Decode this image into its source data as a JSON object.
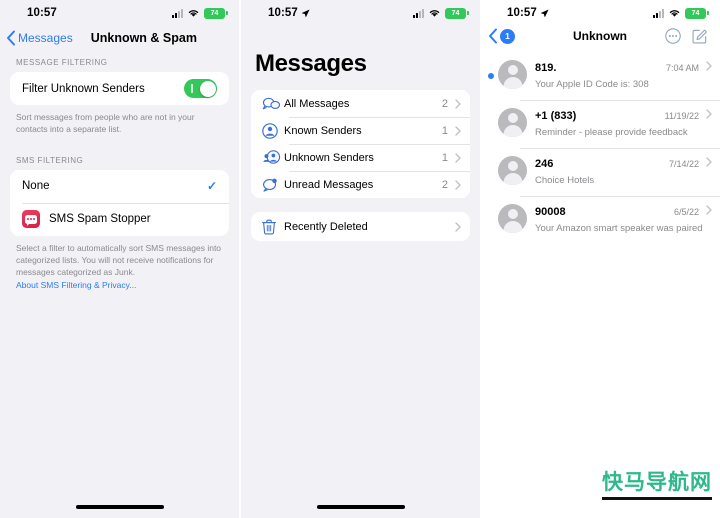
{
  "status_bar": {
    "time": "10:57",
    "battery_level": "74",
    "battery_color": "#34c759",
    "location_icon": "location-arrow-icon",
    "wifi_icon": "wifi-icon",
    "cellular_icon": "cellular-signal-icon"
  },
  "panel1": {
    "nav": {
      "back_label": "Messages",
      "title": "Unknown & Spam",
      "back_icon": "chevron-left-icon"
    },
    "message_filtering": {
      "section_header": "MESSAGE FILTERING",
      "row_label": "Filter Unknown Senders",
      "toggle_state": "on",
      "toggle_color": "#34c759",
      "footnote": "Sort messages from people who are not in your contacts into a separate list."
    },
    "sms_filtering": {
      "section_header": "SMS FILTERING",
      "options": [
        {
          "label": "None",
          "selected": true,
          "icon": null
        },
        {
          "label": "SMS Spam Stopper",
          "selected": false,
          "icon": "sms-spam-stopper-app-icon"
        }
      ],
      "footnote": "Select a filter to automatically sort SMS messages into categorized lists. You will not receive notifications for messages categorized as Junk.",
      "link_label": "About SMS Filtering & Privacy..."
    }
  },
  "panel2": {
    "title": "Messages",
    "filters": [
      {
        "label": "All Messages",
        "count": "2",
        "icon": "two-bubbles-icon"
      },
      {
        "label": "Known Senders",
        "count": "1",
        "icon": "person-circle-icon"
      },
      {
        "label": "Unknown Senders",
        "count": "1",
        "icon": "two-persons-icon"
      },
      {
        "label": "Unread Messages",
        "count": "2",
        "icon": "bubble-dot-icon"
      }
    ],
    "recently_deleted": {
      "label": "Recently Deleted",
      "icon": "trash-icon"
    }
  },
  "panel3": {
    "nav": {
      "back_icon": "chevron-left-icon",
      "back_badge": "1",
      "title": "Unknown",
      "more_icon": "ellipsis-circle-icon",
      "compose_icon": "compose-icon"
    },
    "messages": [
      {
        "sender": "819.",
        "preview": "Your Apple ID Code is: 308",
        "time": "7:04 AM",
        "unread": true
      },
      {
        "sender": "+1 (833)",
        "preview": "Reminder - please provide feedback",
        "time": "11/19/22",
        "unread": false
      },
      {
        "sender": "246",
        "preview": "Choice Hotels",
        "time": "7/14/22",
        "unread": false
      },
      {
        "sender": "90008",
        "preview": "Your Amazon smart speaker was paired",
        "time": "6/5/22",
        "unread": false
      }
    ]
  },
  "watermark": {
    "text": "快马导航网",
    "color": "#2fb88a"
  }
}
